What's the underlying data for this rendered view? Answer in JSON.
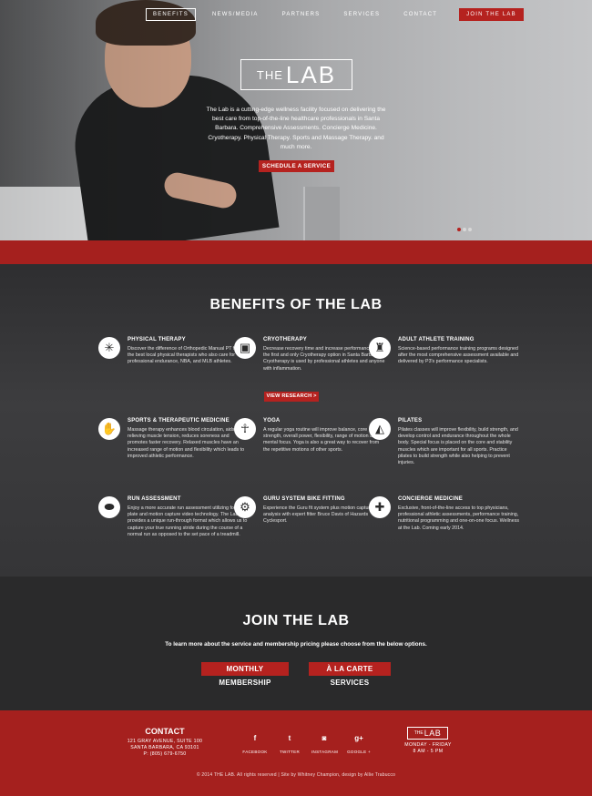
{
  "nav": {
    "items": [
      {
        "label": "BENEFITS",
        "active": true
      },
      {
        "label": "NEWS/MEDIA",
        "active": false
      },
      {
        "label": "PARTNERS",
        "active": false
      },
      {
        "label": "SERVICES",
        "active": false
      },
      {
        "label": "CONTACT",
        "active": false
      }
    ],
    "join_label": "JOIN THE LAB"
  },
  "hero": {
    "logo_the": "THE",
    "logo_lab": "LAB",
    "description": "The Lab is a cutting-edge wellness facility focused on delivering the best care from top-of-the-line healthcare professionals in Santa Barbara. Comprehensive Assessments. Concierge Medicine. Cryotherapy. Physical Therapy. Sports and Massage Therapy. and much more.",
    "cta_label": "SCHEDULE A SERVICE",
    "slides": 3,
    "active_slide": 1
  },
  "benefits": {
    "title": "BENEFITS OF THE LAB",
    "items": [
      {
        "title": "PHYSICAL THERAPY",
        "icon": "vitruvian-icon",
        "text": "Discover the difference of Orthopedic Manual PT from the best local physical therapists who also care for professional endurance, NBA, and MLB athletes."
      },
      {
        "title": "CRYOTHERAPY",
        "icon": "cryo-chamber-icon",
        "text": "Decrease recovery time and increase performance with the first and only Cryotherapy option in Santa Barbara. Cryotherapy is used by professional athletes and anyone with inflammation."
      },
      {
        "title": "ADULT ATHLETE TRAINING",
        "icon": "weightlifter-icon",
        "text": "Science-based performance training programs designed after the most comprehensive assessment available and delivered by P3's performance specialists."
      },
      {
        "title": "SPORTS & THERAPEUTIC MEDICINE",
        "icon": "massage-hands-icon",
        "text": "Massage therapy enhances blood circulation, aids in relieving muscle tension, reduces soreness and promotes faster recovery. Relaxed muscles have an increased range of motion and flexibility which leads to improved athletic performance."
      },
      {
        "title": "YOGA",
        "icon": "yoga-pose-icon",
        "text": "A regular yoga routine will improve balance, core strength, overall power, flexibility, range of motion and mental focus. Yoga is also a great way to recover from the repetitive motions of other sports."
      },
      {
        "title": "PILATES",
        "icon": "pilates-pose-icon",
        "text": "Pilates classes will improve flexibility, build strength, and develop control and endurance throughout the whole body. Special focus is placed on the core and stability muscles which are important for all sports. Practice pilates to build strength while also helping to prevent injuries."
      },
      {
        "title": "RUN ASSESSMENT",
        "icon": "running-shoe-icon",
        "text": "Enjoy a more accurate run assessment utilizing force plate and motion capture video technology. The Lab provides a unique run-through format which allows us to capture your true running stride during the course of a normal run as opposed to the set pace of a treadmill."
      },
      {
        "title": "GURU SYSTEM BIKE FITTING",
        "icon": "bicycle-icon",
        "text": "Experience the Guru fit system plus motion capture video analysis with expert fitter Bruce Davis of Hazards Cyclesport."
      },
      {
        "title": "CONCIERGE MEDICINE",
        "icon": "medical-cross-icon",
        "text": "Exclusive, front-of-the-line access to top physicians, professional athletic assessments, performance training, nutritional programming and one-on-one focus. Wellness at the Lab. Coming early 2014."
      }
    ],
    "view_research_label": "VIEW RESEARCH >"
  },
  "join": {
    "title": "JOIN THE LAB",
    "subtitle": "To learn more about the service and membership pricing please choose from the below options.",
    "monthly_label": "MONTHLY MEMBERSHIP",
    "alacarte_label": "À LA CARTE SERVICES"
  },
  "footer": {
    "contact_title": "CONTACT",
    "address1": "121 GRAY AVENUE, SUITE 100",
    "address2": "SANTA BARBARA, CA 93101",
    "phone": "P: (805) 679-6750",
    "socials": [
      {
        "glyph": "f",
        "label": "FACEBOOK",
        "icon": "facebook-icon"
      },
      {
        "glyph": "t",
        "label": "TWITTER",
        "icon": "twitter-icon"
      },
      {
        "glyph": "◙",
        "label": "INSTAGRAM",
        "icon": "instagram-icon"
      },
      {
        "glyph": "g+",
        "label": "GOOGLE +",
        "icon": "google-plus-icon"
      }
    ],
    "logo_the": "THE",
    "logo_lab": "LAB",
    "hours_days": "MONDAY - FRIDAY",
    "hours_time": "8 AM - 5 PM",
    "copyright": "© 2014 THE LAB. All rights reserved | Site by Whitney Champion, design by Allie Trabucco"
  }
}
